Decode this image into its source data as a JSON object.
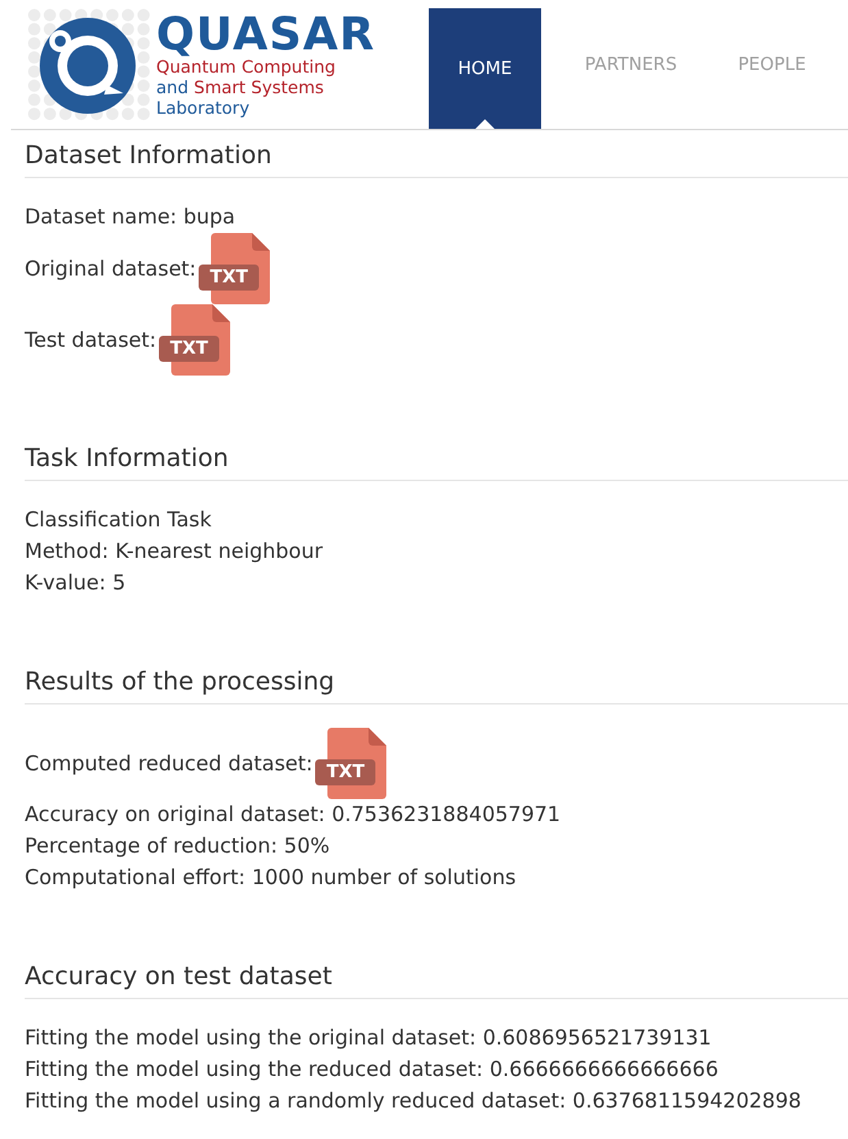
{
  "header": {
    "logo": {
      "title": "QUASAR",
      "lines": [
        [
          {
            "text": "Quantum Computing",
            "kind": "accent"
          }
        ],
        [
          {
            "text": "and",
            "kind": "plain"
          },
          {
            "text": "Smart Systems",
            "kind": "accent"
          }
        ],
        [
          {
            "text": "Laboratory",
            "kind": "plain"
          }
        ]
      ]
    },
    "nav": [
      {
        "label": "HOME",
        "selected": true
      },
      {
        "label": "PARTNERS",
        "selected": false
      },
      {
        "label": "PEOPLE",
        "selected": false
      }
    ]
  },
  "sections": [
    {
      "heading": "Dataset Information",
      "items": [
        {
          "kind": "text",
          "text": "Dataset name: bupa"
        },
        {
          "kind": "file",
          "text": "Original dataset:",
          "badge": "TXT"
        },
        {
          "kind": "file",
          "text": "Test dataset:",
          "badge": "TXT"
        }
      ]
    },
    {
      "heading": "Task Information",
      "items": [
        {
          "kind": "text",
          "text": "Classification Task"
        },
        {
          "kind": "text",
          "text": "Method: K-nearest neighbour"
        },
        {
          "kind": "text",
          "text": "K-value: 5"
        }
      ]
    },
    {
      "heading": "Results of the processing",
      "items": [
        {
          "kind": "file",
          "text": "Computed reduced dataset:",
          "badge": "TXT"
        },
        {
          "kind": "text",
          "text": "Accuracy on original dataset: 0.7536231884057971"
        },
        {
          "kind": "text",
          "text": "Percentage of reduction: 50%"
        },
        {
          "kind": "text",
          "text": "Computational effort: 1000 number of solutions"
        }
      ]
    },
    {
      "heading": "Accuracy on test dataset",
      "items": [
        {
          "kind": "text",
          "text": "Fitting the model using the original dataset: 0.6086956521739131"
        },
        {
          "kind": "text",
          "text": "Fitting the model using the reduced dataset: 0.6666666666666666"
        },
        {
          "kind": "text",
          "text": "Fitting the model using a randomly reduced dataset: 0.6376811594202898"
        }
      ]
    }
  ]
}
